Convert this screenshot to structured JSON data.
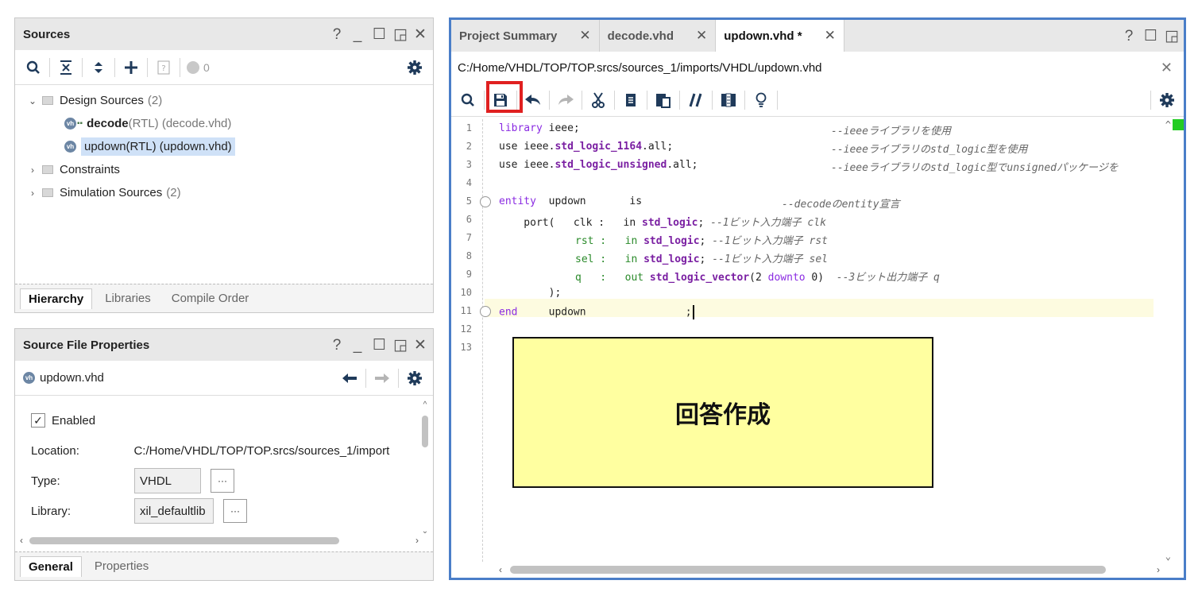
{
  "sources_panel": {
    "title": "Sources",
    "help": "?",
    "minimize": "_",
    "restore": "☐",
    "float": "◲",
    "close": "✕",
    "badge_count": "0",
    "tree": {
      "design_sources": {
        "label": "Design Sources",
        "count": "(2)"
      },
      "decode": {
        "name": "decode",
        "detail": "(RTL) (decode.vhd)"
      },
      "updown": {
        "name": "updown(RTL) (updown.vhd)"
      },
      "constraints": {
        "label": "Constraints"
      },
      "simulation": {
        "label": "Simulation Sources",
        "count": "(2)"
      }
    },
    "tabs": [
      "Hierarchy",
      "Libraries",
      "Compile Order"
    ]
  },
  "properties_panel": {
    "title": "Source File Properties",
    "file": "updown.vhd",
    "enabled_label": "Enabled",
    "location_label": "Location:",
    "location_value": "C:/Home/VHDL/TOP/TOP.srcs/sources_1/import",
    "type_label": "Type:",
    "type_value": "VHDL",
    "library_label": "Library:",
    "library_value": "xil_defaultlib",
    "ellipsis": "···",
    "tabs": [
      "General",
      "Properties"
    ]
  },
  "editor": {
    "tabs": [
      {
        "label": "Project Summary"
      },
      {
        "label": "decode.vhd"
      },
      {
        "label": "updown.vhd *"
      }
    ],
    "path": "C:/Home/VHDL/TOP/TOP.srcs/sources_1/imports/VHDL/updown.vhd",
    "line_numbers": [
      "1",
      "2",
      "3",
      "4",
      "5",
      "6",
      "7",
      "8",
      "9",
      "10",
      "11",
      "12",
      "13"
    ],
    "code": {
      "l1a": "library",
      "l1b": " ieee;",
      "l1c": "--ieeeライブラリを使用",
      "l2a": "use ieee.",
      "l2b": "std_logic_1164",
      "l2c": ".all;",
      "l2d": "--ieeeライブラリのstd_logic型を使用",
      "l3a": "use ieee.",
      "l3b": "std_logic_unsigned",
      "l3c": ".all;",
      "l3d": "--ieeeライブラリのstd_logic型でunsignedパッケージを",
      "l5a": "entity",
      "l5b": "  updown       is",
      "l5c": "--decodeのentity宣言",
      "l6a": "    port(   clk :   in ",
      "l6b": "std_logic",
      "l6c": "; ",
      "l6d": "--1ビット入力端子 clk",
      "l7a": "rst :   in ",
      "l7b": "std_logic",
      "l7c": "; ",
      "l7d": "--1ビット入力端子 rst",
      "l8a": "sel :   in ",
      "l8b": "std_logic",
      "l8c": "; ",
      "l8d": "--1ビット入力端子 sel",
      "l9a": "q   :   out ",
      "l9b": "std_logic_vector",
      "l9c": "(2 ",
      "l9d": "downto",
      "l9e": " 0)  ",
      "l9f": "--3ビット出力端子 q",
      "l10": "        );",
      "l11a": "end",
      "l11b": "     updown                ;"
    }
  },
  "callout": {
    "text": "回答作成"
  }
}
